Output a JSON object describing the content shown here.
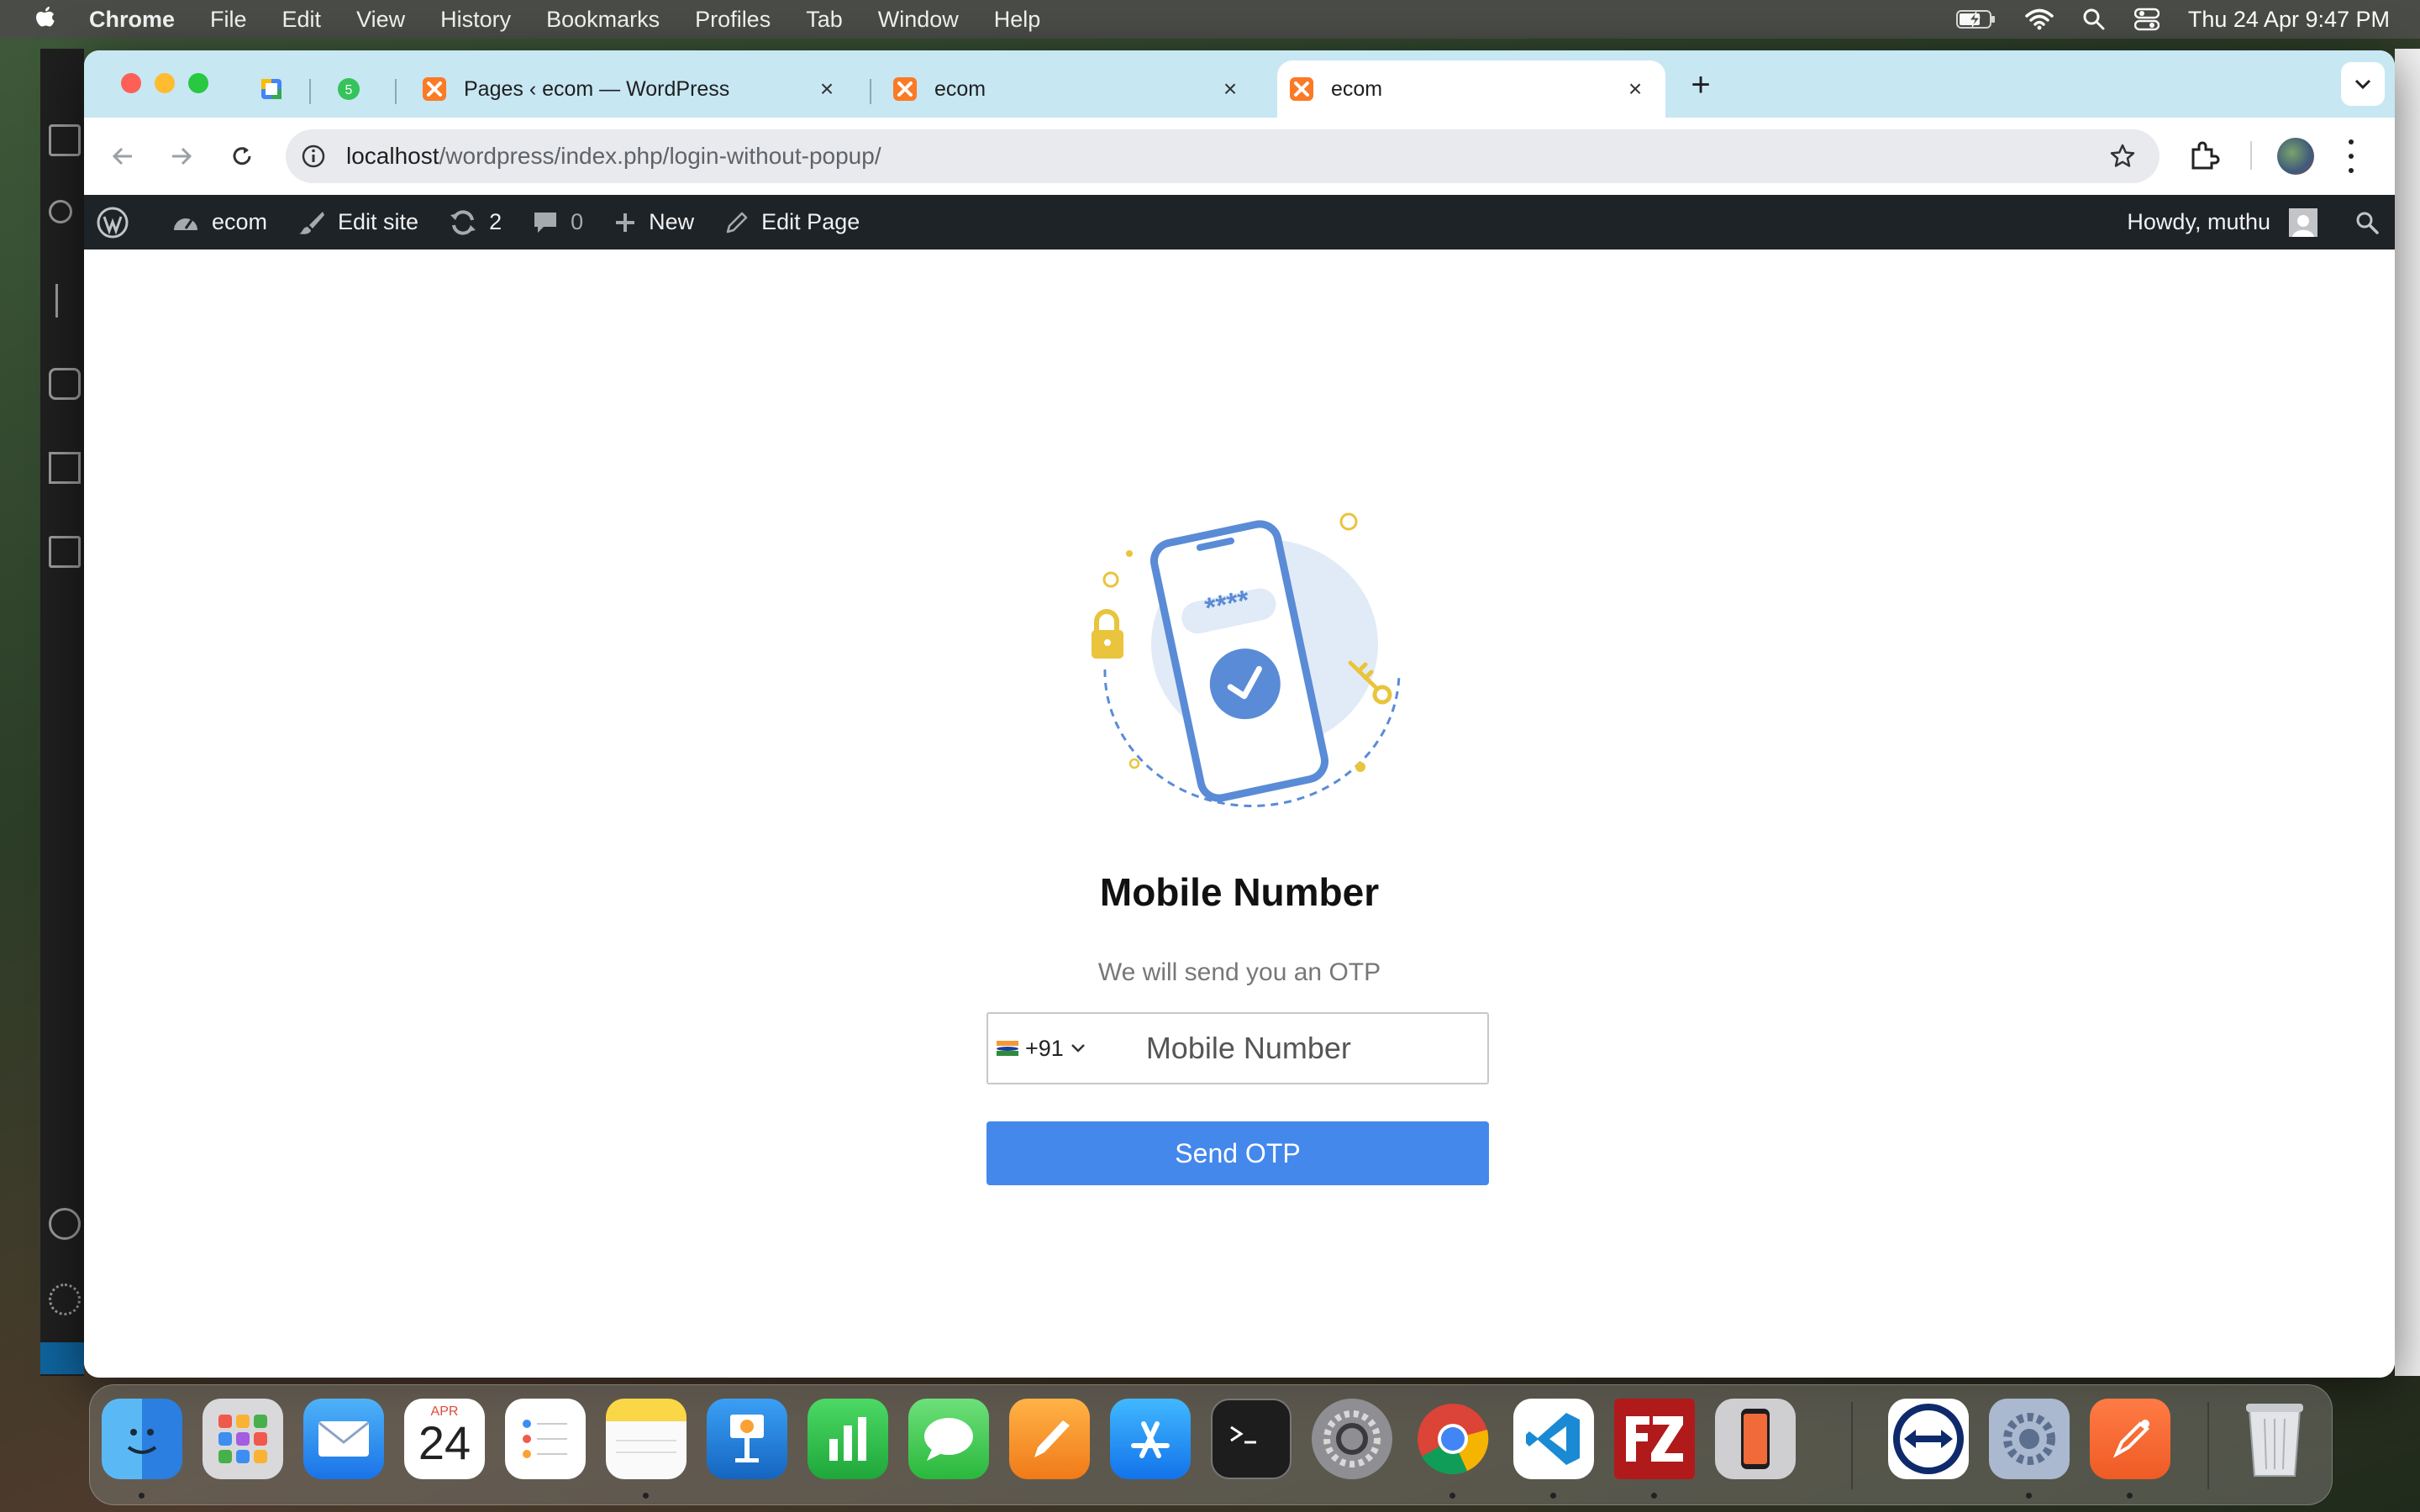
{
  "menubar": {
    "app": "Chrome",
    "items": [
      "File",
      "Edit",
      "View",
      "History",
      "Bookmarks",
      "Profiles",
      "Tab",
      "Window",
      "Help"
    ],
    "clock": "Thu 24 Apr  9:47 PM"
  },
  "browser": {
    "tabs": [
      {
        "title": "",
        "icon": "calendar-favicon"
      },
      {
        "title": "",
        "icon": "whatsapp-favicon",
        "badge": "5"
      },
      {
        "title": "Pages ‹ ecom — WordPress",
        "icon": "xampp-favicon"
      },
      {
        "title": "ecom",
        "icon": "xampp-favicon"
      },
      {
        "title": "ecom",
        "icon": "xampp-favicon",
        "active": true
      }
    ],
    "url_host": "localhost",
    "url_path": "/wordpress/index.php/login-without-popup/"
  },
  "adminbar": {
    "site": "ecom",
    "edit_site": "Edit site",
    "updates": "2",
    "comments": "0",
    "new": "New",
    "edit_page": "Edit Page",
    "howdy": "Howdy, muthu"
  },
  "login": {
    "heading": "Mobile Number",
    "subtext": "We will send you an OTP",
    "country_code": "+91",
    "mobile_placeholder": "Mobile Number",
    "mobile_value": "",
    "send_label": "Send OTP",
    "otp_mask": "****"
  },
  "dock": {
    "calendar_month": "APR",
    "calendar_day": "24",
    "apps": [
      "Finder",
      "Launchpad",
      "Mail",
      "Calendar",
      "Reminders",
      "Notes",
      "Keynote",
      "Numbers",
      "Messages",
      "Pages",
      "App Store",
      "Terminal",
      "System Settings",
      "Google Chrome",
      "Visual Studio Code",
      "FileZilla",
      "Simulator",
      "TeamViewer",
      "Settings",
      "Postman",
      "Trash"
    ]
  },
  "colors": {
    "accent": "#4488ec",
    "tabstrip": "#c7e7f3",
    "wp_bar": "#1d2327",
    "illus_phone": "#5a8bd6",
    "illus_yellow": "#e9c43c"
  }
}
